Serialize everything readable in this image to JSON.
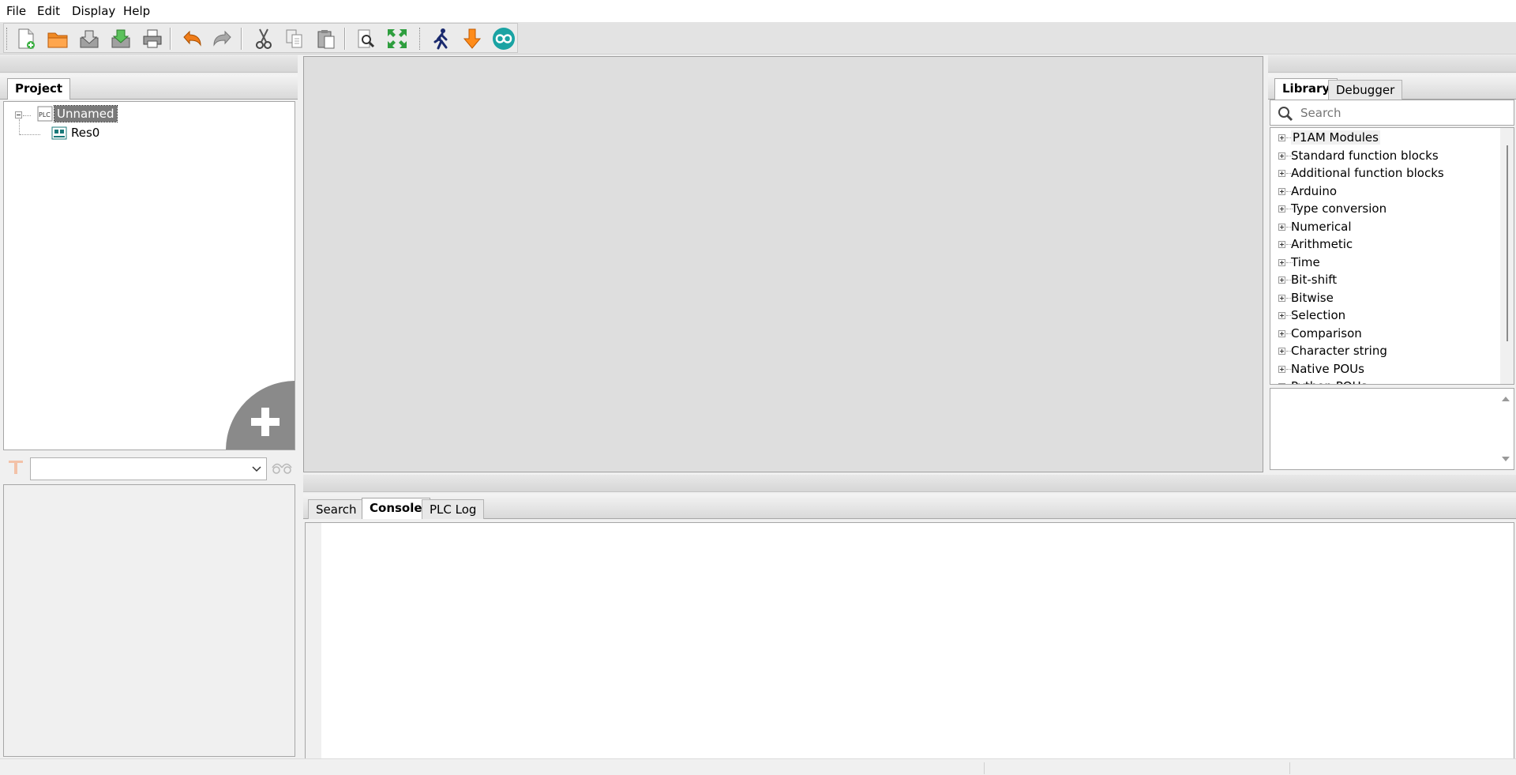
{
  "menu": [
    "File",
    "Edit",
    "Display",
    "Help"
  ],
  "toolbar": {
    "buttons": [
      "new-file-icon",
      "open-folder-icon",
      "save-icon",
      "save-as-icon",
      "print-icon",
      "undo-icon",
      "redo-icon",
      "cut-icon",
      "copy-icon",
      "paste-icon",
      "find-icon",
      "fullscreen-icon",
      "run-icon",
      "download-icon",
      "arduino-icon"
    ]
  },
  "project": {
    "tab": "Project",
    "root": "Unnamed",
    "child": "Res0",
    "add_button": "add-icon"
  },
  "library": {
    "tabs": [
      "Library",
      "Debugger"
    ],
    "search_placeholder": "Search",
    "items": [
      "P1AM Modules",
      "Standard function blocks",
      "Additional function blocks",
      "Arduino",
      "Type conversion",
      "Numerical",
      "Arithmetic",
      "Time",
      "Bit-shift",
      "Bitwise",
      "Selection",
      "Comparison",
      "Character string",
      "Native POUs",
      "Python POUs"
    ]
  },
  "bottom": {
    "tabs": [
      "Search",
      "Console",
      "PLC Log"
    ],
    "active_tab": "Console"
  },
  "colors": {
    "accent": "#ff8c1a",
    "arduino": "#1aa3a3",
    "selection": "#7a7a7a"
  }
}
